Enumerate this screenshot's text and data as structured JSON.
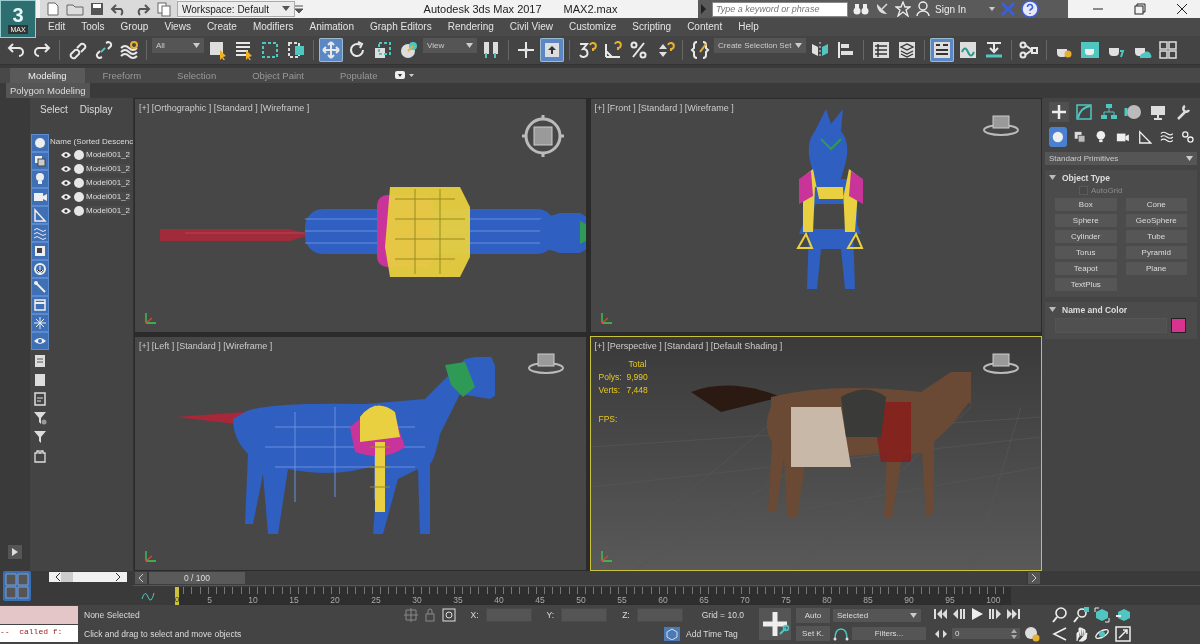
{
  "title_bar": {
    "logo": {
      "glyph": "3",
      "caption": "MAX"
    },
    "workspace": "Workspace: Default",
    "app_title": "Autodesk 3ds Max 2017",
    "file_name": "MAX2.max",
    "search": {
      "placeholder": "Type a keyword or phrase"
    },
    "sign_in": "Sign In"
  },
  "menu": [
    "Edit",
    "Tools",
    "Group",
    "Views",
    "Create",
    "Modifiers",
    "Animation",
    "Graph Editors",
    "Rendering",
    "Civil View",
    "Customize",
    "Scripting",
    "Content",
    "Help"
  ],
  "toolbar": {
    "selection_filter": "All",
    "reference_coordinate": "View",
    "selection_set": "Create Selection Set",
    "buttons": [
      {
        "selected": false
      },
      {
        "selected": false
      },
      {
        "selected": false
      },
      {
        "selected": false
      },
      {
        "selected": false
      },
      {
        "selected": false
      },
      {
        "selected": false
      },
      {
        "selected": false
      },
      {
        "selected": false
      },
      {
        "selected": true
      },
      {
        "selected": false
      },
      {
        "selected": false
      },
      {
        "selected": false
      },
      {
        "selected": false
      },
      {
        "selected": false
      },
      {
        "selected": true
      },
      {
        "selected": false
      },
      {
        "selected": false
      },
      {
        "selected": false
      },
      {
        "selected": false
      },
      {
        "selected": false
      },
      {
        "selected": false
      },
      {
        "selected": false
      },
      {
        "selected": false
      },
      {
        "selected": false
      },
      {
        "selected": true
      },
      {
        "selected": false
      },
      {
        "selected": false
      },
      {
        "selected": false
      },
      {
        "selected": false
      },
      {
        "selected": false
      },
      {
        "selected": false
      },
      {
        "selected": false
      },
      {
        "selected": false
      }
    ]
  },
  "ribbon": {
    "tabs": [
      {
        "label": "Modeling",
        "selected": true
      },
      {
        "label": "Freeform",
        "selected": false
      },
      {
        "label": "Selection",
        "selected": false
      },
      {
        "label": "Object Paint",
        "selected": false
      },
      {
        "label": "Populate",
        "selected": false
      }
    ],
    "panel": "Polygon Modeling"
  },
  "scene_explorer": {
    "tabs": [
      "Select",
      "Display"
    ],
    "column": "Name (Sorted Descenc",
    "filters": [
      {
        "on": true
      },
      {
        "on": true
      },
      {
        "on": true
      },
      {
        "on": true
      },
      {
        "on": true
      },
      {
        "on": true
      },
      {
        "on": true
      },
      {
        "on": true
      },
      {
        "on": true
      },
      {
        "on": true
      },
      {
        "on": true
      },
      {
        "on": true
      }
    ],
    "rows": [
      "Model001_2",
      "Model001_2",
      "Model001_2",
      "Model001_2",
      "Model001_2"
    ]
  },
  "viewports": [
    {
      "label": "[+] [Orthographic ] [Standard ] [Wireframe ]",
      "kind": "top",
      "selected": false
    },
    {
      "label": "[+] [Front ] [Standard ] [Wireframe ]",
      "kind": "front",
      "selected": false
    },
    {
      "label": "[+] [Left ] [Standard ] [Wireframe ]",
      "kind": "side",
      "selected": false
    },
    {
      "label": "[+] [Perspective ] [Standard ] [Default Shading ]",
      "kind": "perspective",
      "selected": true,
      "stats": {
        "title": "Total",
        "rows": [
          {
            "label": "Polys:",
            "value": "9,990"
          },
          {
            "label": "Verts:",
            "value": "7,448"
          }
        ],
        "fps": "FPS:"
      }
    }
  ],
  "command_panel": {
    "tabs": [
      {
        "selected": true
      },
      {
        "selected": false
      },
      {
        "selected": false
      },
      {
        "selected": false
      },
      {
        "selected": false
      },
      {
        "selected": false
      }
    ],
    "categories": [
      {
        "selected": true
      },
      {
        "selected": false
      },
      {
        "selected": false
      },
      {
        "selected": false
      },
      {
        "selected": false
      },
      {
        "selected": false
      },
      {
        "selected": false
      }
    ],
    "dropdown": "Standard Primitives",
    "object_type": {
      "title": "Object Type",
      "expanded": true,
      "autogrid": {
        "label": "AutoGrid",
        "checked": false,
        "disabled": true
      },
      "buttons": [
        "Box",
        "Cone",
        "Sphere",
        "GeoSphere",
        "Cylinder",
        "Tube",
        "Torus",
        "Pyramid",
        "Teapot",
        "Plane",
        "TextPlus"
      ]
    },
    "name_and_color": {
      "title": "Name and Color",
      "expanded": true,
      "color": "#d6348f"
    }
  },
  "timeline": {
    "frame": "0 / 100",
    "level": 0,
    "current": "0",
    "ticks": [
      "5",
      "10",
      "15",
      "20",
      "25",
      "30",
      "35",
      "40",
      "45",
      "50",
      "55",
      "60",
      "65",
      "70",
      "75",
      "80",
      "85",
      "90",
      "95",
      "100"
    ]
  },
  "status_bar": {
    "maxscript": "--  called f:",
    "selection": "None Selected",
    "prompt": "Click and drag to select and move objects",
    "x_label": "X:",
    "y_label": "Y:",
    "z_label": "Z:",
    "grid": "Grid = 10.0",
    "time_tag": "Add Time Tag",
    "auto_key": "Auto",
    "set_key": "Set K.",
    "key_filter": "Selected",
    "filters": "Filters...",
    "frame_field": "0"
  }
}
